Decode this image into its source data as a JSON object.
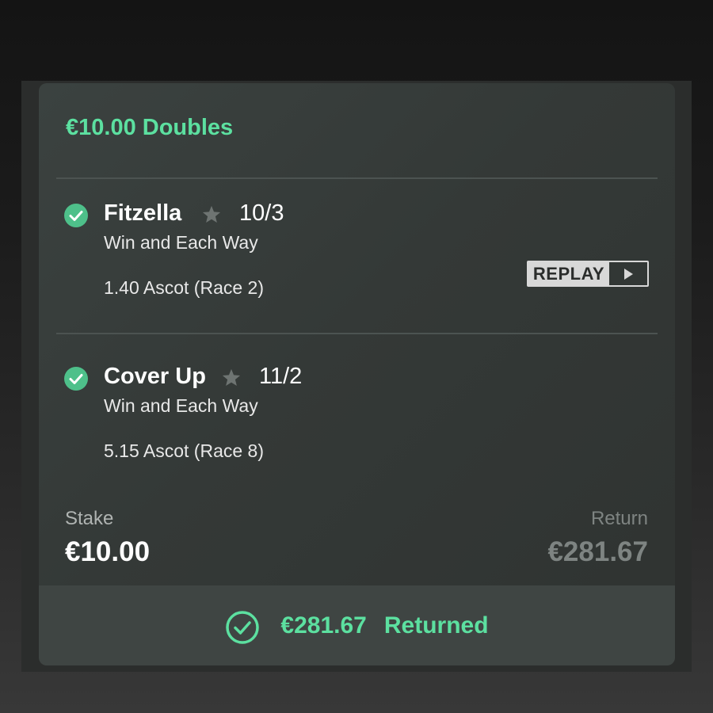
{
  "bet": {
    "title": "€10.00 Doubles",
    "selections": [
      {
        "name": "Fitzella",
        "odds": "10/3",
        "bet_type": "Win and Each Way",
        "race": "1.40 Ascot (Race 2)",
        "status": "won"
      },
      {
        "name": "Cover Up",
        "odds": "11/2",
        "bet_type": "Win and Each Way",
        "race": "5.15 Ascot (Race 8)",
        "status": "won"
      }
    ],
    "replay_label": "REPLAY",
    "stake_label": "Stake",
    "stake_value": "€10.00",
    "return_label": "Return",
    "return_value": "€281.67",
    "footer": {
      "amount": "€281.67",
      "status": "Returned"
    }
  },
  "icons": {
    "selection_status": "check-circle-icon",
    "favourite": "star-icon",
    "replay": "play-icon",
    "footer": "check-circle-outline-icon"
  },
  "colors": {
    "accent": "#5ce0a0",
    "check_fill": "#4ec08a",
    "card_bg": "#363b39",
    "footer_bg": "#3f4543",
    "muted_text": "#7e8482"
  }
}
